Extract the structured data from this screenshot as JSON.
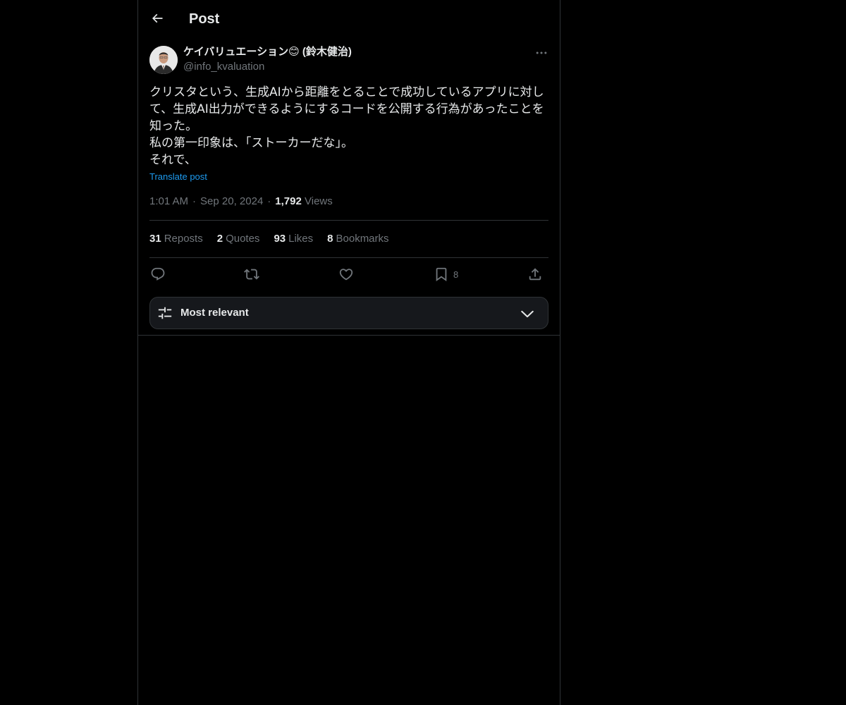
{
  "header": {
    "title": "Post",
    "back_icon": "arrow-left-icon"
  },
  "author": {
    "display_name": "ケイバリュエーション😊 (鈴木健治)",
    "handle": "@info_kvaluation",
    "more_icon": "more-horizontal-icon"
  },
  "tweet": {
    "lines": [
      "クリスタという、生成AIから距離をとることで成功しているアプリに対し",
      "て、生成AI出力ができるようにするコードを公開する行為があったことを",
      "知った。",
      "私の第一印象は、「ストーカーだな」。",
      "それで、"
    ],
    "translate_label": "Translate post",
    "time": "1:01 AM",
    "date": "Sep 20, 2024",
    "views_count": "1,792",
    "views_label": "Views"
  },
  "stats": {
    "reposts_count": "31",
    "reposts_label": "Reposts",
    "quotes_count": "2",
    "quotes_label": "Quotes",
    "likes_count": "93",
    "likes_label": "Likes",
    "bookmarks_count": "8",
    "bookmarks_label": "Bookmarks"
  },
  "actions": {
    "reply_icon": "reply-icon",
    "repost_icon": "repost-icon",
    "like_icon": "heart-icon",
    "bookmark_icon": "bookmark-icon",
    "bookmark_count": "8",
    "share_icon": "share-icon"
  },
  "replies_sort": {
    "label": "Most relevant",
    "icon": "sliders-icon",
    "chevron": "chevron-down-icon"
  },
  "colors": {
    "background": "#000000",
    "text": "#e7e9ea",
    "secondary": "#71767b",
    "link": "#1d9bf0",
    "border": "#2f3336"
  },
  "separators": {
    "dot": "·"
  }
}
